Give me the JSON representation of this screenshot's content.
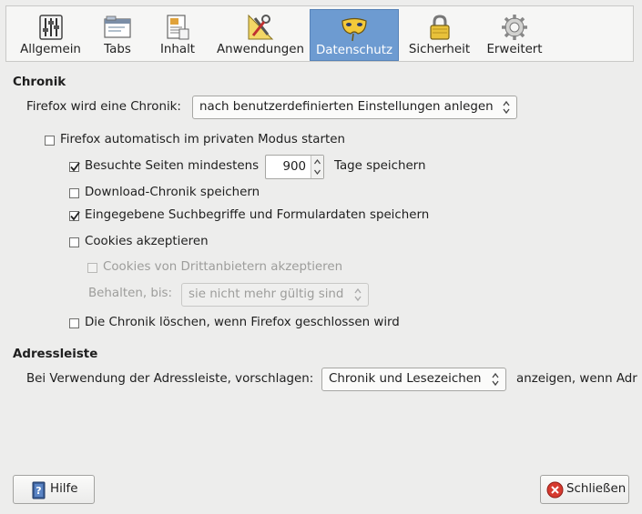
{
  "tabs": [
    {
      "label": "Allgemein",
      "icon": "sliders-icon"
    },
    {
      "label": "Tabs",
      "icon": "tabs-window-icon"
    },
    {
      "label": "Inhalt",
      "icon": "document-icon"
    },
    {
      "label": "Anwendungen",
      "icon": "tools-icon"
    },
    {
      "label": "Datenschutz",
      "icon": "mask-icon",
      "active": true
    },
    {
      "label": "Sicherheit",
      "icon": "padlock-icon"
    },
    {
      "label": "Erweitert",
      "icon": "gear-icon"
    }
  ],
  "history": {
    "heading": "Chronik",
    "mode_label": "Firefox wird eine Chronik:",
    "mode_value": "nach benutzerdefinierten Einstellungen anlegen",
    "private_mode": {
      "label": "Firefox automatisch im privaten Modus starten",
      "checked": false
    },
    "visited": {
      "label": "Besuchte Seiten mindestens",
      "checked": true,
      "days": "900",
      "suffix": "Tage speichern"
    },
    "downloads": {
      "label": "Download-Chronik speichern",
      "checked": false
    },
    "search_forms": {
      "label": "Eingegebene Suchbegriffe und Formulardaten speichern",
      "checked": true
    },
    "cookies": {
      "label": "Cookies akzeptieren",
      "checked": false
    },
    "third_party": {
      "label": "Cookies von Drittanbietern akzeptieren",
      "checked": false,
      "disabled": true
    },
    "keep_label": "Behalten, bis:",
    "keep_value": "sie nicht mehr gültig sind",
    "clear_on_close": {
      "label": "Die Chronik löschen, wenn Firefox geschlossen wird",
      "checked": false
    }
  },
  "urlbar": {
    "heading": "Adressleiste",
    "label": "Bei Verwendung der Adressleiste, vorschlagen:",
    "value": "Chronik und Lesezeichen",
    "suffix": "anzeigen, wenn Adr"
  },
  "buttons": {
    "help": "Hilfe",
    "close": "Schließen"
  },
  "colors": {
    "active_tab": "#6d9bd1",
    "window_bg": "#ededec"
  }
}
